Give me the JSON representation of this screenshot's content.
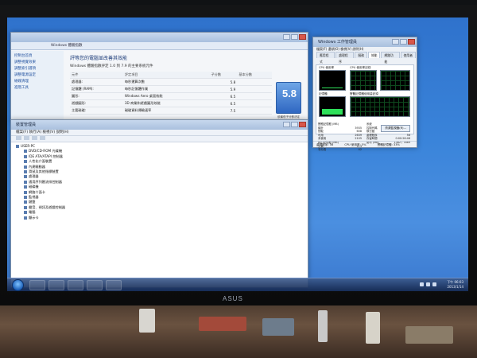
{
  "monitor": {
    "brand": "ASUS"
  },
  "system_window": {
    "address": "Windows 體驗指數",
    "sidebar": [
      "控制台首頁",
      "調整視覺效果",
      "調整索引選項",
      "調整電源設定",
      "磁碟清理",
      "進階工具"
    ],
    "heading": "評等您的電腦並改善其效能",
    "subtitle": "Windows 體驗指數評定 1.0 到 7.9 的主要系統元件",
    "table_headers": [
      "元件",
      "評定項目",
      "子分數",
      "基本分數"
    ],
    "rows": [
      {
        "component": "處理器:",
        "desc": "每秒運算次數",
        "score": "5.8"
      },
      {
        "component": "記憶體 (RAM):",
        "desc": "每秒記憶體作業",
        "score": "5.9"
      },
      {
        "component": "圖形:",
        "desc": "Windows Aero 桌面效能",
        "score": "6.5"
      },
      {
        "component": "遊戲圖形:",
        "desc": "3D 商業和遊戲圖形效能",
        "score": "6.5"
      },
      {
        "component": "主要磁碟:",
        "desc": "磁碟資料傳輸速率",
        "score": "7.5"
      }
    ],
    "base_score": "5.8",
    "base_caption": "依最低子分數決定"
  },
  "device_manager": {
    "title": "裝置管理員",
    "menu": "檔案(F)  執行(A)  檢視(V)  說明(H)",
    "root": "USER-PC",
    "items": [
      "DVD/CD-ROM 光碟機",
      "IDE ATA/ATAPI 控制器",
      "人性化介面裝置",
      "內建驅動器",
      "滑鼠及其他指標裝置",
      "處理器",
      "通用序列匯流排控制器",
      "磁碟機",
      "網路介面卡",
      "監視器",
      "鍵盤",
      "聲音、視訊及遊戲控制器",
      "電腦",
      "顯示卡"
    ]
  },
  "task_manager": {
    "title": "Windows 工作管理員",
    "menu": "檔案(F)  選項(O)  檢視(V)  說明(H)",
    "tabs": [
      "應用程式",
      "處理程序",
      "服務",
      "效能",
      "網路功能",
      "使用者"
    ],
    "labels": {
      "cpu_usage": "CPU 使用率",
      "cpu_history": "CPU 使用率記錄",
      "mem": "記憶體",
      "mem_history": "實體記憶體使用量記錄"
    },
    "cpu_percent": 5,
    "memory_percent": 33,
    "mem_label": "1.28 GB",
    "stats_left": [
      {
        "k": "實體記憶體 (MB)",
        "v": ""
      },
      {
        "k": "總計",
        "v": "3935"
      },
      {
        "k": "快取",
        "v": "608"
      },
      {
        "k": "可用",
        "v": "2639"
      },
      {
        "k": "未使用",
        "v": "2105"
      },
      {
        "k": "核心記憶體 (MB)",
        "v": ""
      },
      {
        "k": "分頁",
        "v": "113"
      },
      {
        "k": "非分頁",
        "v": "42"
      }
    ],
    "stats_right": [
      {
        "k": "系統",
        "v": ""
      },
      {
        "k": "控制代碼",
        "v": "17166"
      },
      {
        "k": "執行緒",
        "v": "667"
      },
      {
        "k": "處理程序",
        "v": "56"
      },
      {
        "k": "存留時間",
        "v": "0:00:26:46"
      },
      {
        "k": "認可 (MB)",
        "v": "1382 / 7869"
      }
    ],
    "resource_button": "資源監視器(R)...",
    "status": [
      "處理程序: 56",
      "CPU 使用率: 5%",
      "實體記憶體: 33%"
    ]
  },
  "taskbar": {
    "time": "下午 06:03",
    "date": "2013/1/14"
  }
}
